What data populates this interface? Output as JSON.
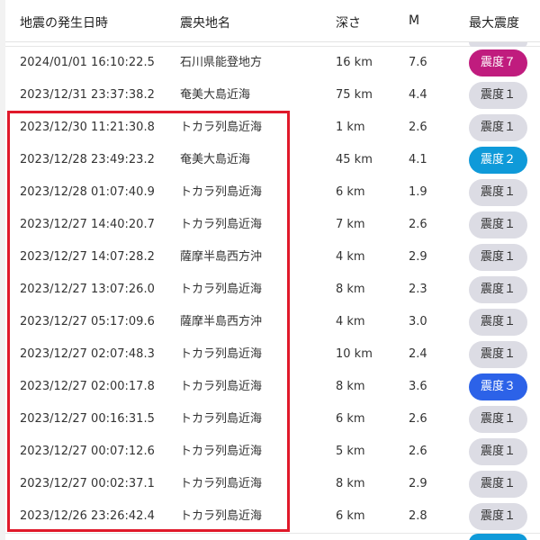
{
  "header": {
    "date": "地震の発生日時",
    "location": "震央地名",
    "depth": "深さ",
    "magnitude": "M",
    "intensity": "最大震度"
  },
  "rows": [
    {
      "date": "2024/01/01 16:10:22.5",
      "location": "石川県能登地方",
      "depth": "16 km",
      "magnitude": "7.6",
      "intensity": "震度７",
      "level": 7,
      "color": "#c01c7e"
    },
    {
      "date": "2023/12/31 23:37:38.2",
      "location": "奄美大島近海",
      "depth": "75 km",
      "magnitude": "4.4",
      "intensity": "震度１",
      "level": 1,
      "color": "#dcdce4"
    },
    {
      "date": "2023/12/30 11:21:30.8",
      "location": "トカラ列島近海",
      "depth": "1 km",
      "magnitude": "2.6",
      "intensity": "震度１",
      "level": 1,
      "color": "#dcdce4"
    },
    {
      "date": "2023/12/28 23:49:23.2",
      "location": "奄美大島近海",
      "depth": "45 km",
      "magnitude": "4.1",
      "intensity": "震度２",
      "level": 2,
      "color": "#0f9ad9"
    },
    {
      "date": "2023/12/28 01:07:40.9",
      "location": "トカラ列島近海",
      "depth": "6 km",
      "magnitude": "1.9",
      "intensity": "震度１",
      "level": 1,
      "color": "#dcdce4"
    },
    {
      "date": "2023/12/27 14:40:20.7",
      "location": "トカラ列島近海",
      "depth": "7 km",
      "magnitude": "2.6",
      "intensity": "震度１",
      "level": 1,
      "color": "#dcdce4"
    },
    {
      "date": "2023/12/27 14:07:28.2",
      "location": "薩摩半島西方沖",
      "depth": "4 km",
      "magnitude": "2.9",
      "intensity": "震度１",
      "level": 1,
      "color": "#dcdce4"
    },
    {
      "date": "2023/12/27 13:07:26.0",
      "location": "トカラ列島近海",
      "depth": "8 km",
      "magnitude": "2.3",
      "intensity": "震度１",
      "level": 1,
      "color": "#dcdce4"
    },
    {
      "date": "2023/12/27 05:17:09.6",
      "location": "薩摩半島西方沖",
      "depth": "4 km",
      "magnitude": "3.0",
      "intensity": "震度１",
      "level": 1,
      "color": "#dcdce4"
    },
    {
      "date": "2023/12/27 02:07:48.3",
      "location": "トカラ列島近海",
      "depth": "10 km",
      "magnitude": "2.4",
      "intensity": "震度１",
      "level": 1,
      "color": "#dcdce4"
    },
    {
      "date": "2023/12/27 02:00:17.8",
      "location": "トカラ列島近海",
      "depth": "8 km",
      "magnitude": "3.6",
      "intensity": "震度３",
      "level": 3,
      "color": "#2c62e8"
    },
    {
      "date": "2023/12/27 00:16:31.5",
      "location": "トカラ列島近海",
      "depth": "6 km",
      "magnitude": "2.6",
      "intensity": "震度１",
      "level": 1,
      "color": "#dcdce4"
    },
    {
      "date": "2023/12/27 00:07:12.6",
      "location": "トカラ列島近海",
      "depth": "5 km",
      "magnitude": "2.6",
      "intensity": "震度１",
      "level": 1,
      "color": "#dcdce4"
    },
    {
      "date": "2023/12/27 00:02:37.1",
      "location": "トカラ列島近海",
      "depth": "8 km",
      "magnitude": "2.9",
      "intensity": "震度１",
      "level": 1,
      "color": "#dcdce4"
    },
    {
      "date": "2023/12/26 23:26:42.4",
      "location": "トカラ列島近海",
      "depth": "6 km",
      "magnitude": "2.8",
      "intensity": "震度１",
      "level": 1,
      "color": "#dcdce4"
    }
  ],
  "next_row_badge_color": "#0f9ad9",
  "highlight_color": "#e0192a"
}
